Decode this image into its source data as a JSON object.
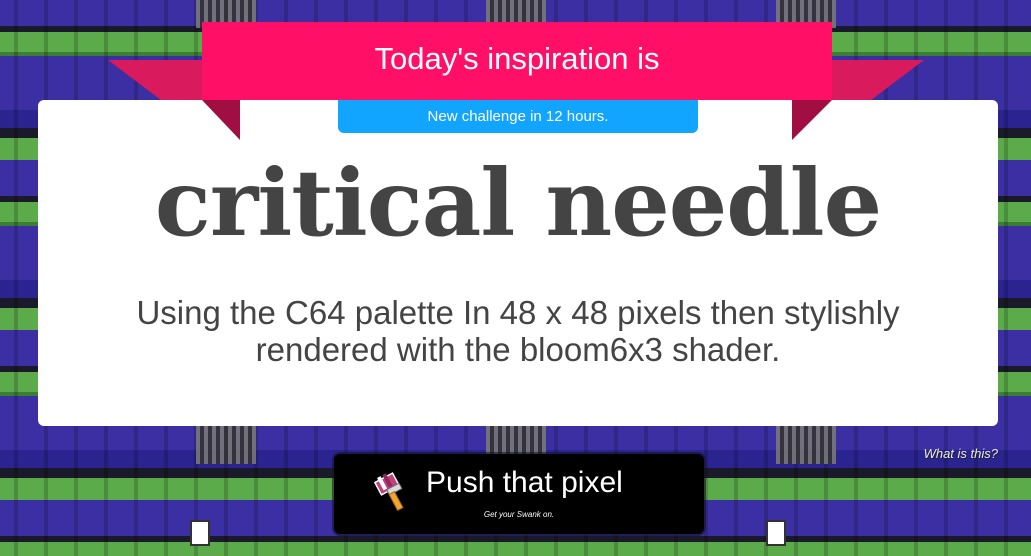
{
  "ribbon": {
    "title": "Today's inspiration is",
    "color": "#ff0f65"
  },
  "timer": {
    "text": "New challenge in 12 hours.",
    "color": "#11a5ff"
  },
  "challenge": {
    "phrase": "critical needle",
    "description": "Using the C64 palette In 48 x 48 pixels then stylishly rendered with the bloom6x3 shader."
  },
  "help_link": {
    "label": "What is this?"
  },
  "cta": {
    "label": "Push that pixel",
    "sub_label": "Get your Swank on.",
    "icon": "paintbrush-icon"
  }
}
